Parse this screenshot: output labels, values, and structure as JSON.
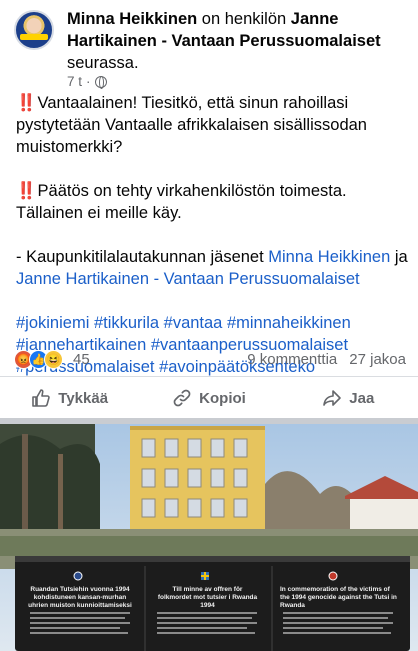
{
  "header": {
    "author": "Minna Heikkinen",
    "connector": "on henkilön",
    "page": "Janne Hartikainen - Vantaan Perussuomalaiset",
    "suffix": "seurassa.",
    "time": "7 t",
    "separator": "·",
    "privacy_icon": "globe-icon"
  },
  "post": {
    "line1_emoji": "‼️",
    "line1": "Vantaalainen! Tiesitkö, että sinun rahoillasi pystytetään Vantaalle afrikkalaisen sisällissodan muistomerkki?",
    "line2_emoji": "‼️",
    "line2": "Päätös on tehty virkahenkilöstön toimesta. Tällainen ei meille käy.",
    "line3_prefix": "- Kaupunkitilalautakunnan jäsenet ",
    "mention1": "Minna Heikkinen",
    "line3_and": " ja ",
    "mention2": "Janne Hartikainen - Vantaan Perussuomalaiset",
    "hashtags": "#jokiniemi #tikkurila #vantaa #minnaheikkinen #jannehartikainen #vantaanperussuomalaiset #perussuomalaiset #avoinpäätöksenteko"
  },
  "stats": {
    "reaction_icons": [
      "angry-icon",
      "like-icon",
      "haha-icon"
    ],
    "reaction_count": "45",
    "comments": "9 kommenttia",
    "shares": "27 jakoa"
  },
  "actions": {
    "like": "Tykkää",
    "copy": "Kopioi",
    "share": "Jaa"
  },
  "photo": {
    "sign_col1_title": "Ruandan Tutsiehin vuonna 1994 kohdistuneen kansan-murhan uhrien muiston kunnioittamiseksi",
    "sign_col2_title": "Till minne av offren för folkmordet mot tutsier i Rwanda 1994",
    "sign_col3_title": "In commemoration of the victims of the 1994 genocide against the Tutsi in Rwanda"
  },
  "colors": {
    "link": "#1b5fc9",
    "text": "#050505",
    "secondary": "#65676b",
    "like_blue": "#1877f2"
  }
}
